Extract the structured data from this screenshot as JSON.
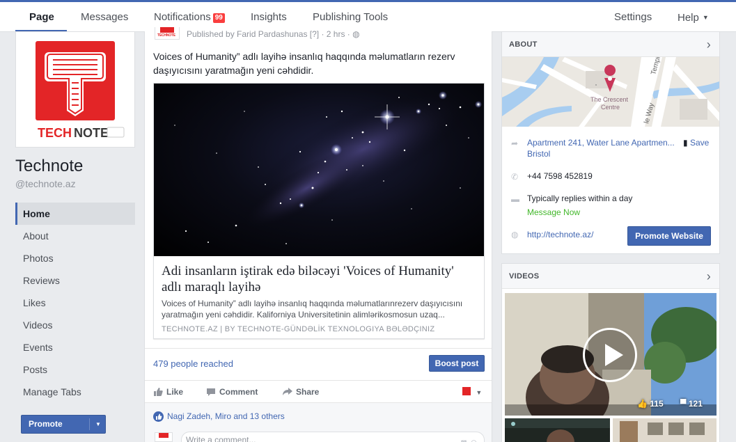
{
  "nav_tabs": [
    {
      "label": "Page"
    },
    {
      "label": "Messages"
    },
    {
      "label": "Notifications",
      "badge": "99"
    },
    {
      "label": "Insights"
    },
    {
      "label": "Publishing Tools"
    }
  ],
  "nav_right": {
    "settings": "Settings",
    "help": "Help"
  },
  "page": {
    "logo_text_red": "TECH",
    "logo_text_dark": "NOTE",
    "name": "Technote",
    "handle": "@technote.az"
  },
  "sidebar": {
    "items": [
      {
        "label": "Home"
      },
      {
        "label": "About"
      },
      {
        "label": "Photos"
      },
      {
        "label": "Reviews"
      },
      {
        "label": "Likes"
      },
      {
        "label": "Videos"
      },
      {
        "label": "Events"
      },
      {
        "label": "Posts"
      },
      {
        "label": "Manage Tabs"
      }
    ],
    "promote_label": "Promote"
  },
  "post": {
    "avatar_text": "TECHNOTE",
    "meta": "Published by Farid Pardashunas [?] · 2 hrs · ",
    "text": "Voices of Humanity” adlı layihə insanlıq haqqında məlumatların rezerv daşıyıcısını yaratmağın yeni cəhdidir.",
    "link": {
      "title": "Adi insanların iştirak edə biləcəyi 'Voices of Humanity' adlı maraqlı layihə",
      "description": "Voices of Humanity” adlı layihə insanlıq haqqında məlumatlarınrezerv daşıyıcısını yaratmağın yeni cəhdidir. Kaliforniya Universitetinin alimlərikosmosun uzaq...",
      "source": "TECHNOTE.AZ | BY TECHNOTE-GÜNDƏLİK TEXNOLOGIYA BƏLƏDÇINIZ"
    },
    "reach": "479 people reached",
    "boost_label": "Boost post",
    "actions": {
      "like": "Like",
      "comment": "Comment",
      "share": "Share"
    },
    "reactions": "Nagi Zadeh, Miro and 13 others",
    "comment_placeholder": "Write a comment..."
  },
  "about": {
    "header": "ABOUT",
    "map_label_1": "The Crescent",
    "map_label_2": "Centre",
    "map_road_1": "Temple",
    "map_road_2": "le Way",
    "address_line1": "Apartment 241, Water Lane Apartmen...",
    "address_line2": "Bristol",
    "save_label": "Save",
    "phone": "+44 7598 452819",
    "replies": "Typically replies within a day",
    "message_now": "Message Now",
    "website": "http://technote.az/",
    "promote_website": "Promote Website"
  },
  "videos": {
    "header": "VIDEOS",
    "likes": "115",
    "comments": "121"
  },
  "colors": {
    "brand_blue": "#4267b2",
    "logo_red": "#e32527",
    "badge_red": "#fa3e3e",
    "green": "#42b72a"
  }
}
